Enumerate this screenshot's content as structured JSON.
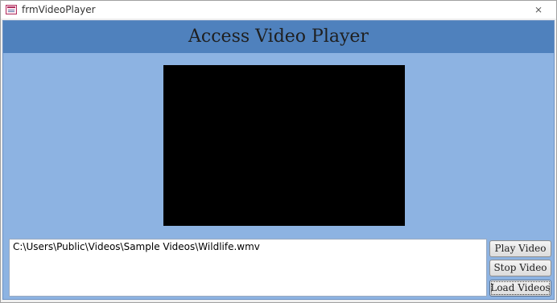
{
  "window": {
    "title": "frmVideoPlayer",
    "close_symbol": "⨯",
    "icon": "access-form-icon"
  },
  "header": {
    "title": "Access Video Player"
  },
  "video": {
    "state": "blank"
  },
  "path_box": {
    "value": "C:\\Users\\Public\\Videos\\Sample Videos\\Wildlife.wmv"
  },
  "buttons": {
    "play": "Play Video",
    "stop": "Stop Video",
    "load": "Load Videos"
  },
  "colors": {
    "header_band": "#4f81bd",
    "form_background": "#8db3e2",
    "video_background": "#000000"
  }
}
